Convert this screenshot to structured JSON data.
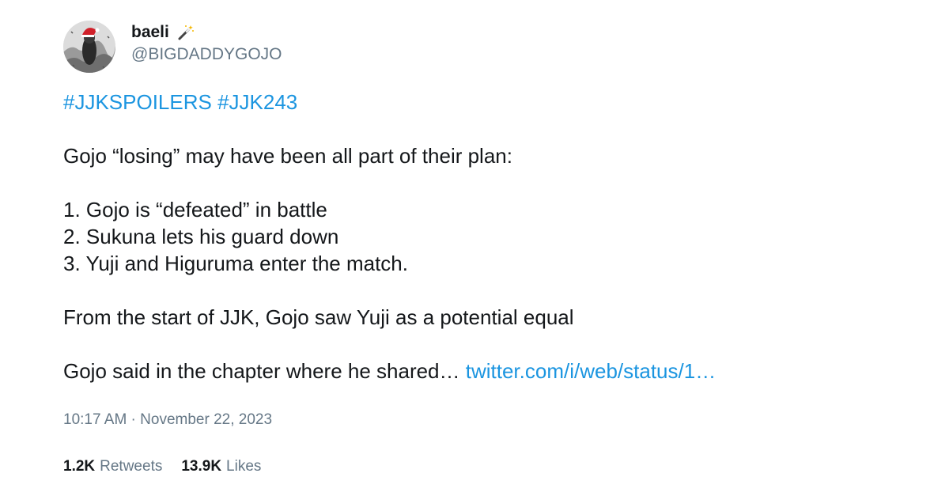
{
  "tweet": {
    "author": {
      "display_name": "baeli",
      "handle": "@BIGDADDYGOJO",
      "name_emoji": "magic-wand-icon"
    },
    "hashtags": "#JJKSPOILERS #JJK243",
    "lines": [
      "Gojo “losing” may have been all part of their plan:",
      "1. Gojo is “defeated” in battle",
      "2. Sukuna lets his guard down",
      "3. Yuji and Higuruma enter the match.",
      "From the start of JJK, Gojo saw Yuji as a potential equal",
      "Gojo said in the chapter where he shared… "
    ],
    "link_text": "twitter.com/i/web/status/1…",
    "timestamp": "10:17 AM · November 22, 2023",
    "retweets": {
      "count": "1.2K",
      "label": "Retweets"
    },
    "likes": {
      "count": "13.9K",
      "label": "Likes"
    }
  },
  "colors": {
    "link": "#1b95e0",
    "secondary_text": "#657786",
    "primary_text": "#14171a"
  }
}
